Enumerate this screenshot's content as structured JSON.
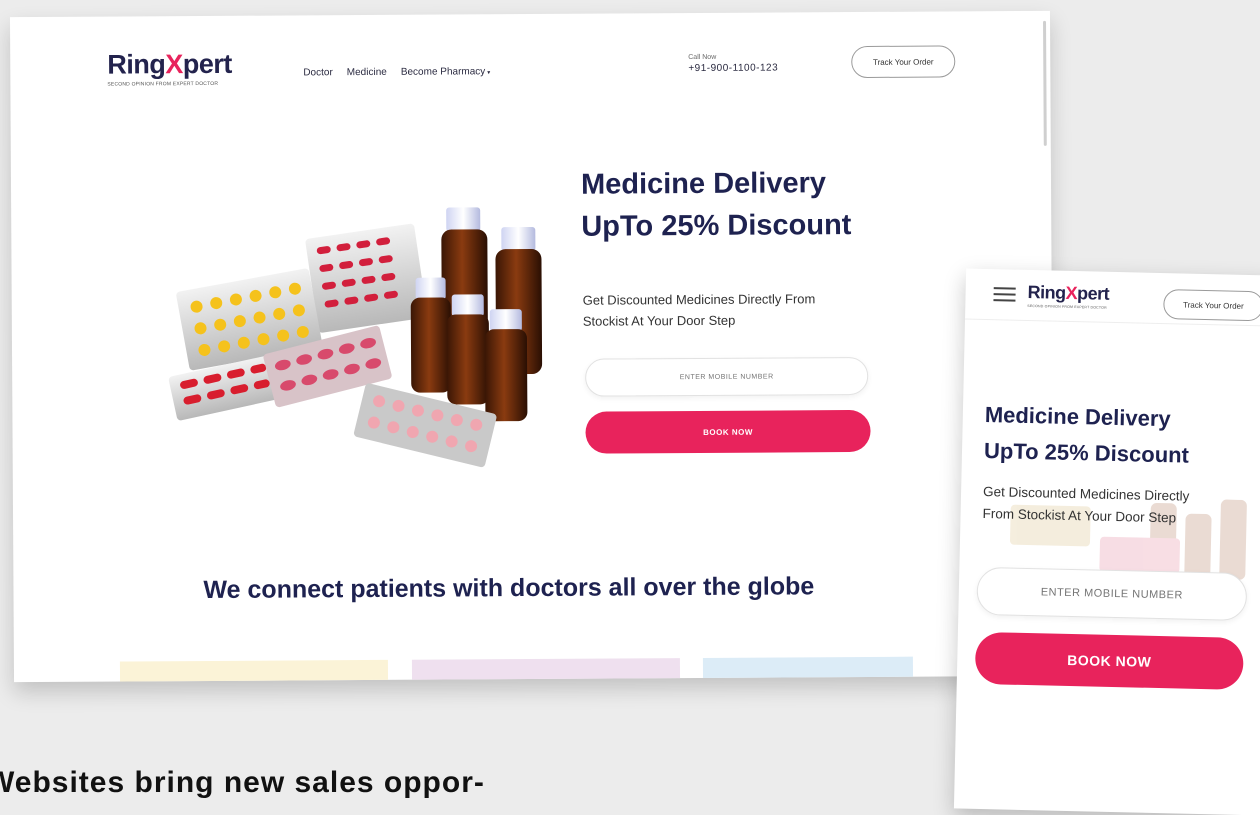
{
  "brand": {
    "name_pre": "Ring",
    "name_x": "X",
    "name_post": "pert",
    "tagline": "SECOND OPINION FROM EXPERT DOCTOR",
    "accent": "#e8235c",
    "navy": "#1e2250"
  },
  "desktop": {
    "nav": [
      "Doctor",
      "Medicine",
      "Become Pharmacy"
    ],
    "call_label": "Call Now",
    "call_number": "+91-900-1100-123",
    "track_label": "Track Your Order",
    "hero_title_line1": "Medicine Delivery",
    "hero_title_line2": "UpTo 25% Discount",
    "hero_sub_line1": "Get Discounted Medicines Directly From",
    "hero_sub_line2": "Stockist At Your Door Step",
    "input_placeholder": "ENTER MOBILE NUMBER",
    "book_label": "BOOK NOW",
    "connect_heading": "We connect patients with doctors all over the globe"
  },
  "mobile": {
    "track_label": "Track Your Order",
    "title_line1": "Medicine Delivery",
    "title_line2": "UpTo 25% Discount",
    "sub_line1": "Get Discounted Medicines Directly",
    "sub_line2": "From Stockist At Your Door Step",
    "input_placeholder": "ENTER MOBILE NUMBER",
    "book_label": "BOOK NOW"
  },
  "caption": "Websites bring new sales oppor-",
  "icons": {
    "menu": "hamburger-menu-icon",
    "dropdown": "caret-down-icon",
    "illustration": "medicine-bottles-and-pills-illustration"
  }
}
